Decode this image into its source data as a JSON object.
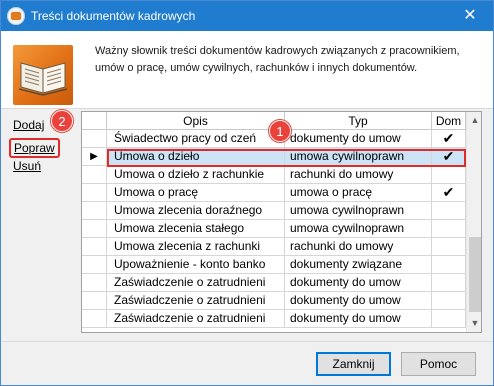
{
  "window": {
    "title": "Treści dokumentów kadrowych",
    "close_glyph": "✕"
  },
  "header": {
    "description": "Ważny słownik treści dokumentów kadrowych związanych z pracownikiem, umów o pracę, umów cywilnych, rachunków i innych dokumentów."
  },
  "side_actions": {
    "add": "Dodaj",
    "edit": "Popraw",
    "delete": "Usuń"
  },
  "grid": {
    "columns": {
      "opis": "Opis",
      "typ": "Typ",
      "dom": "Dom"
    },
    "rows": [
      {
        "opis": "Świadectwo pracy od czeń",
        "typ": "dokumenty do umow",
        "dom": "✔",
        "indicator": ""
      },
      {
        "opis": "Umowa o dzieło",
        "typ": "umowa cywilnoprawn",
        "dom": "✔",
        "indicator": "▶"
      },
      {
        "opis": "Umowa o dzieło z rachunkie",
        "typ": "rachunki do umowy",
        "dom": "",
        "indicator": ""
      },
      {
        "opis": "Umowa o pracę",
        "typ": "umowa o pracę",
        "dom": "✔",
        "indicator": ""
      },
      {
        "opis": "Umowa zlecenia doraźnego",
        "typ": "umowa cywilnoprawn",
        "dom": "",
        "indicator": ""
      },
      {
        "opis": "Umowa zlecenia stałego",
        "typ": "umowa cywilnoprawn",
        "dom": "",
        "indicator": ""
      },
      {
        "opis": "Umowa zlecenia z rachunki",
        "typ": "rachunki do umowy",
        "dom": "",
        "indicator": ""
      },
      {
        "opis": "Upoważnienie - konto banko",
        "typ": "dokumenty związane",
        "dom": "",
        "indicator": ""
      },
      {
        "opis": "Zaświadczenie o zatrudnieni",
        "typ": "dokumenty do umow",
        "dom": "",
        "indicator": ""
      },
      {
        "opis": "Zaświadczenie o zatrudnieni",
        "typ": "dokumenty do umow",
        "dom": "",
        "indicator": ""
      },
      {
        "opis": "Zaświadczenie o zatrudnieni",
        "typ": "dokumenty do umow",
        "dom": "",
        "indicator": ""
      }
    ],
    "selected_index": 1
  },
  "annotations": {
    "badge_1": "1",
    "badge_2": "2"
  },
  "footer": {
    "close": "Zamknij",
    "help": "Pomoc"
  },
  "icons": {
    "app": "app-logo-icon",
    "book": "open-book-icon",
    "row_pointer": "row-pointer-icon",
    "check": "check-icon"
  },
  "colors": {
    "titlebar": "#1f7ccf",
    "selection": "#cce3f6",
    "highlight": "#e02b2b",
    "badge": "#e8423a"
  }
}
